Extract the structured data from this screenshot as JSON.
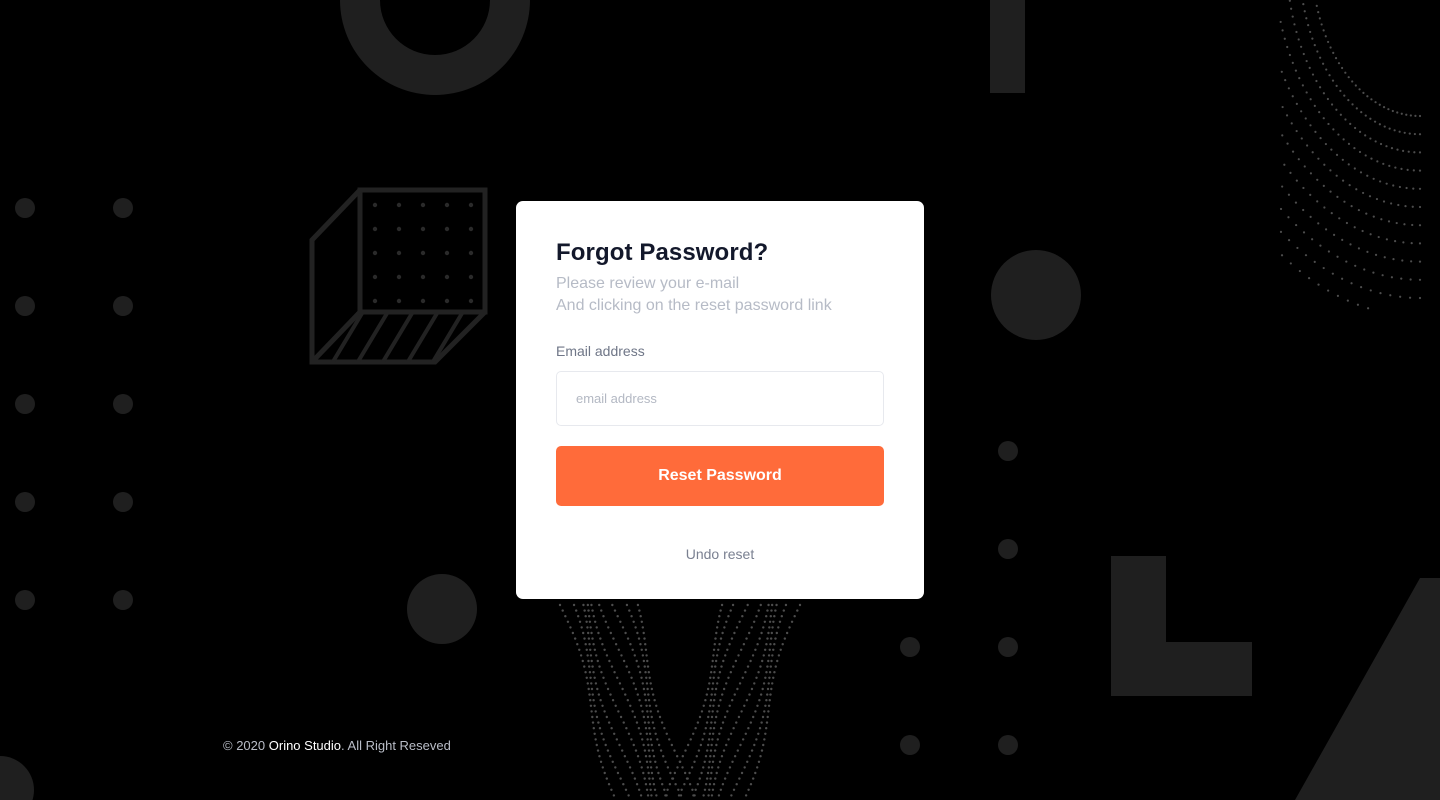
{
  "card": {
    "title": "Forgot Password?",
    "subtitle_line1": "Please review your e-mail",
    "subtitle_line2": "And clicking on the reset password link",
    "email_label": "Email address",
    "email_placeholder": "email address",
    "email_value": "",
    "reset_button_label": "Reset Password",
    "undo_link_label": "Undo reset"
  },
  "footer": {
    "copyright_prefix": "© 2020",
    "brand": "Orino Studio",
    "suffix": ". All Right Reseved"
  },
  "colors": {
    "background": "#000000",
    "card": "#ffffff",
    "accent": "#ff6b3a",
    "title": "#13182b",
    "muted": "#b6bbc6",
    "decoration": "#1f1f1f",
    "stipple": "#5a5a5a"
  },
  "icons": {
    "decorations": [
      "ring-shape",
      "bar-shape",
      "cube-shape",
      "dot-grid",
      "circle-shape",
      "l-shape",
      "triangle-shape",
      "stipple-wave"
    ]
  }
}
